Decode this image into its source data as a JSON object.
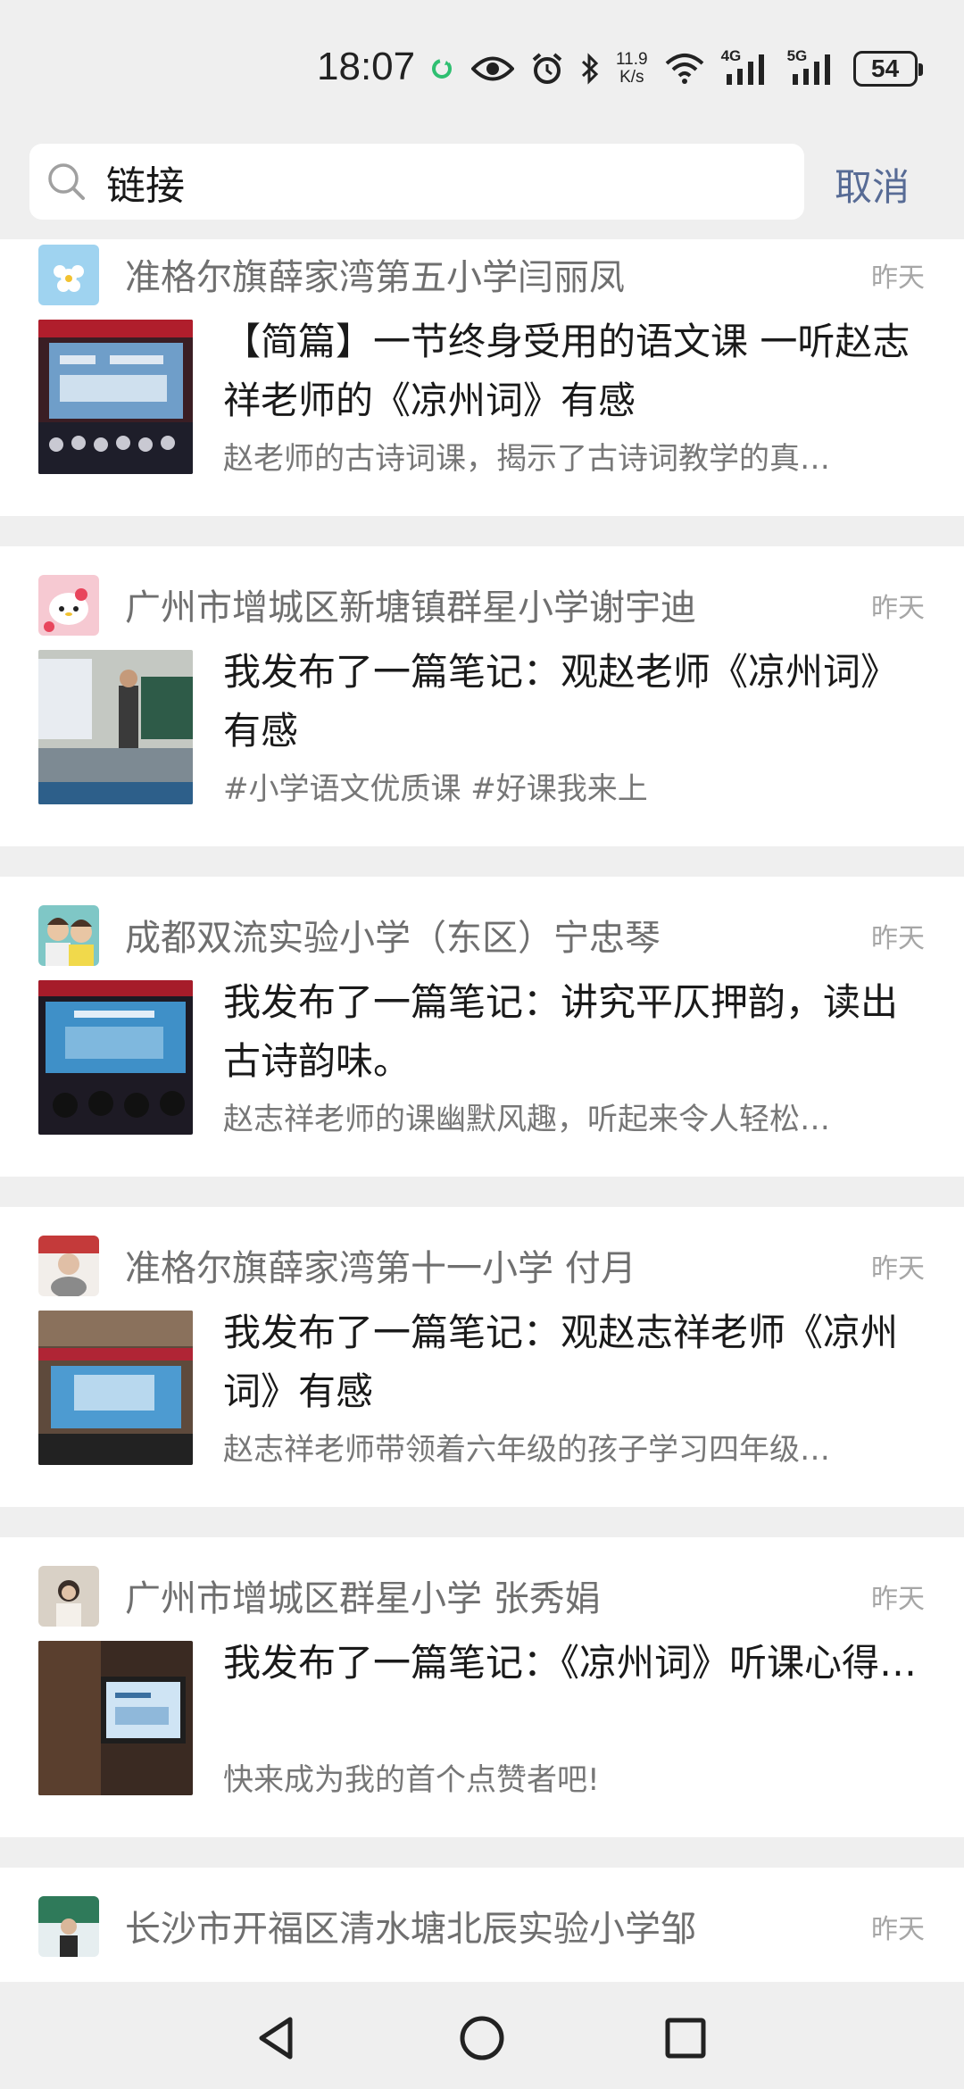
{
  "status": {
    "time": "18:07",
    "speed_top": "11.9",
    "speed_bottom": "K/s",
    "net1": "4G",
    "net2": "5G",
    "battery": "54"
  },
  "search": {
    "value": "链接",
    "cancel_label": "取消"
  },
  "results": [
    {
      "author": "准格尔旗薛家湾第五小学闫丽凤",
      "date": "昨天",
      "title": "【简篇】一节终身受用的语文课 一听赵志祥老师的《凉州词》有感",
      "desc": "赵老师的古诗词课，揭示了古诗词教学的真…"
    },
    {
      "author": "广州市增城区新塘镇群星小学谢宇迪",
      "date": "昨天",
      "title": "我发布了一篇笔记：观赵老师《凉州词》有感",
      "desc": "#小学语文优质课  #好课我来上"
    },
    {
      "author": "成都双流实验小学（东区）宁忠琴",
      "date": "昨天",
      "title": "我发布了一篇笔记：讲究平仄押韵，读出古诗韵味。",
      "desc": "赵志祥老师的课幽默风趣，听起来令人轻松…"
    },
    {
      "author": "准格尔旗薛家湾第十一小学 付月",
      "date": "昨天",
      "title": "我发布了一篇笔记：观赵志祥老师《凉州词》有感",
      "desc": "赵志祥老师带领着六年级的孩子学习四年级…"
    },
    {
      "author": "广州市增城区群星小学 张秀娟",
      "date": "昨天",
      "title": "我发布了一篇笔记：《凉州词》听课心得…",
      "desc": "快来成为我的首个点赞者吧!"
    },
    {
      "author": "长沙市开福区清水塘北辰实验小学邹",
      "date": "昨天"
    }
  ],
  "colors": {
    "link_blue": "#576b95",
    "background": "#efefef"
  }
}
